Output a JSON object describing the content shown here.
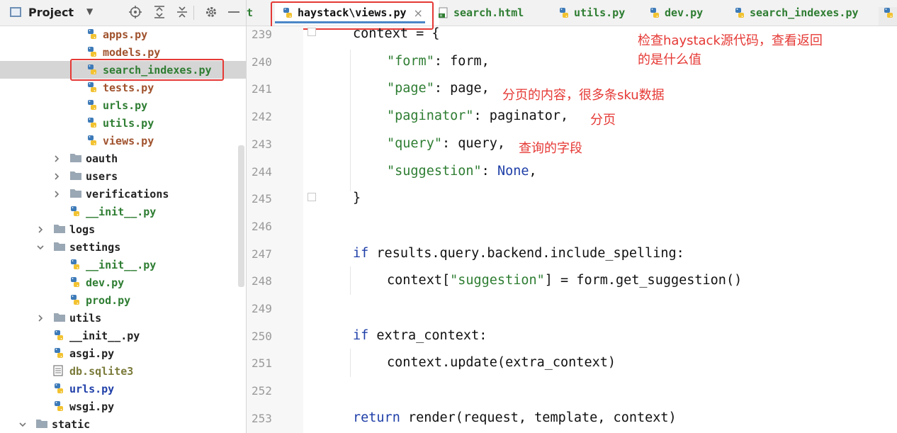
{
  "project_panel": {
    "title": "Project",
    "dropdown": "▼"
  },
  "tree": [
    {
      "label": "apps.py",
      "type": "py",
      "color": "#a0522d",
      "indent": 2,
      "arrow": ""
    },
    {
      "label": "models.py",
      "type": "py",
      "color": "#a0522d",
      "indent": 2,
      "arrow": ""
    },
    {
      "label": "search_indexes.py",
      "type": "py",
      "color": "#2e7d32",
      "indent": 2,
      "arrow": "",
      "selected": true
    },
    {
      "label": "tests.py",
      "type": "py",
      "color": "#a0522d",
      "indent": 2,
      "arrow": ""
    },
    {
      "label": "urls.py",
      "type": "py",
      "color": "#2e7d32",
      "indent": 2,
      "arrow": ""
    },
    {
      "label": "utils.py",
      "type": "py",
      "color": "#2e7d32",
      "indent": 2,
      "arrow": ""
    },
    {
      "label": "views.py",
      "type": "py",
      "color": "#a0522d",
      "indent": 2,
      "arrow": ""
    },
    {
      "label": "oauth",
      "type": "folder",
      "color": "#222222",
      "indent": 1,
      "arrow": "right"
    },
    {
      "label": "users",
      "type": "folder",
      "color": "#222222",
      "indent": 1,
      "arrow": "right"
    },
    {
      "label": "verifications",
      "type": "folder",
      "color": "#222222",
      "indent": 1,
      "arrow": "right"
    },
    {
      "label": "__init__.py",
      "type": "py",
      "color": "#2e7d32",
      "indent": 1,
      "arrow": ""
    },
    {
      "label": "logs",
      "type": "folder",
      "color": "#222222",
      "indent": 0,
      "arrow": "right"
    },
    {
      "label": "settings",
      "type": "folder",
      "color": "#222222",
      "indent": 0,
      "arrow": "down"
    },
    {
      "label": "__init__.py",
      "type": "py",
      "color": "#2e7d32",
      "indent": 1,
      "arrow": ""
    },
    {
      "label": "dev.py",
      "type": "py",
      "color": "#2e7d32",
      "indent": 1,
      "arrow": ""
    },
    {
      "label": "prod.py",
      "type": "py",
      "color": "#2e7d32",
      "indent": 1,
      "arrow": ""
    },
    {
      "label": "utils",
      "type": "folder",
      "color": "#222222",
      "indent": 0,
      "arrow": "right"
    },
    {
      "label": "__init__.py",
      "type": "py",
      "color": "#222222",
      "indent": 0,
      "arrow": ""
    },
    {
      "label": "asgi.py",
      "type": "py",
      "color": "#222222",
      "indent": 0,
      "arrow": ""
    },
    {
      "label": "db.sqlite3",
      "type": "db",
      "color": "#7a7a3a",
      "indent": 0,
      "arrow": ""
    },
    {
      "label": "urls.py",
      "type": "py",
      "color": "#1f3fa8",
      "indent": 0,
      "arrow": ""
    },
    {
      "label": "wsgi.py",
      "type": "py",
      "color": "#222222",
      "indent": 0,
      "arrow": ""
    },
    {
      "label": "static",
      "type": "folder",
      "color": "#222222",
      "indent": -1,
      "arrow": "down"
    }
  ],
  "tabs": [
    {
      "label": "t",
      "type": "none",
      "color": "#2e7d32"
    },
    {
      "label": "haystack\\views.py",
      "type": "py",
      "color": "#111111",
      "active": true
    },
    {
      "label": "search.html",
      "type": "html",
      "color": "#2e7d32"
    },
    {
      "label": "utils.py",
      "type": "py",
      "color": "#2e7d32"
    },
    {
      "label": "dev.py",
      "type": "py",
      "color": "#2e7d32"
    },
    {
      "label": "search_indexes.py",
      "type": "py",
      "color": "#2e7d32"
    }
  ],
  "close_glyph": "×",
  "line_numbers": [
    "239",
    "240",
    "241",
    "242",
    "243",
    "244",
    "245",
    "246",
    "247",
    "248",
    "249",
    "250",
    "251",
    "252",
    "253"
  ],
  "code_lines": [
    [
      {
        "t": "context = {",
        "c": ""
      }
    ],
    [
      {
        "t": "\"form\"",
        "c": "str"
      },
      {
        "t": ": form,",
        "c": ""
      }
    ],
    [
      {
        "t": "\"page\"",
        "c": "str"
      },
      {
        "t": ": page,",
        "c": ""
      }
    ],
    [
      {
        "t": "\"paginator\"",
        "c": "str"
      },
      {
        "t": ": paginator,",
        "c": ""
      }
    ],
    [
      {
        "t": "\"query\"",
        "c": "str"
      },
      {
        "t": ": query,",
        "c": ""
      }
    ],
    [
      {
        "t": "\"suggestion\"",
        "c": "str"
      },
      {
        "t": ": ",
        "c": ""
      },
      {
        "t": "None",
        "c": "kw"
      },
      {
        "t": ",",
        "c": ""
      }
    ],
    [
      {
        "t": "}",
        "c": ""
      }
    ],
    [],
    [
      {
        "t": "if",
        "c": "kw"
      },
      {
        "t": " results.query.backend.include_spelling:",
        "c": ""
      }
    ],
    [
      {
        "t": "context[",
        "c": ""
      },
      {
        "t": "\"suggestion\"",
        "c": "str"
      },
      {
        "t": "] = form.get_suggestion()",
        "c": ""
      }
    ],
    [],
    [
      {
        "t": "if",
        "c": "kw"
      },
      {
        "t": " extra_context:",
        "c": ""
      }
    ],
    [
      {
        "t": "context.update(extra_context)",
        "c": ""
      }
    ],
    [],
    [
      {
        "t": "return",
        "c": "kw"
      },
      {
        "t": " render(request, template, context)",
        "c": ""
      }
    ]
  ],
  "annotations": {
    "top_line1": "检查haystack源代码，查看返回",
    "top_line2": "的是什么值",
    "page": "分页的内容，很多条sku数据",
    "paginator": "分页",
    "query": "查询的字段"
  },
  "colors": {
    "highlight_box": "#e53935",
    "keyword": "#1f3fa8",
    "string": "#2e7d32"
  }
}
